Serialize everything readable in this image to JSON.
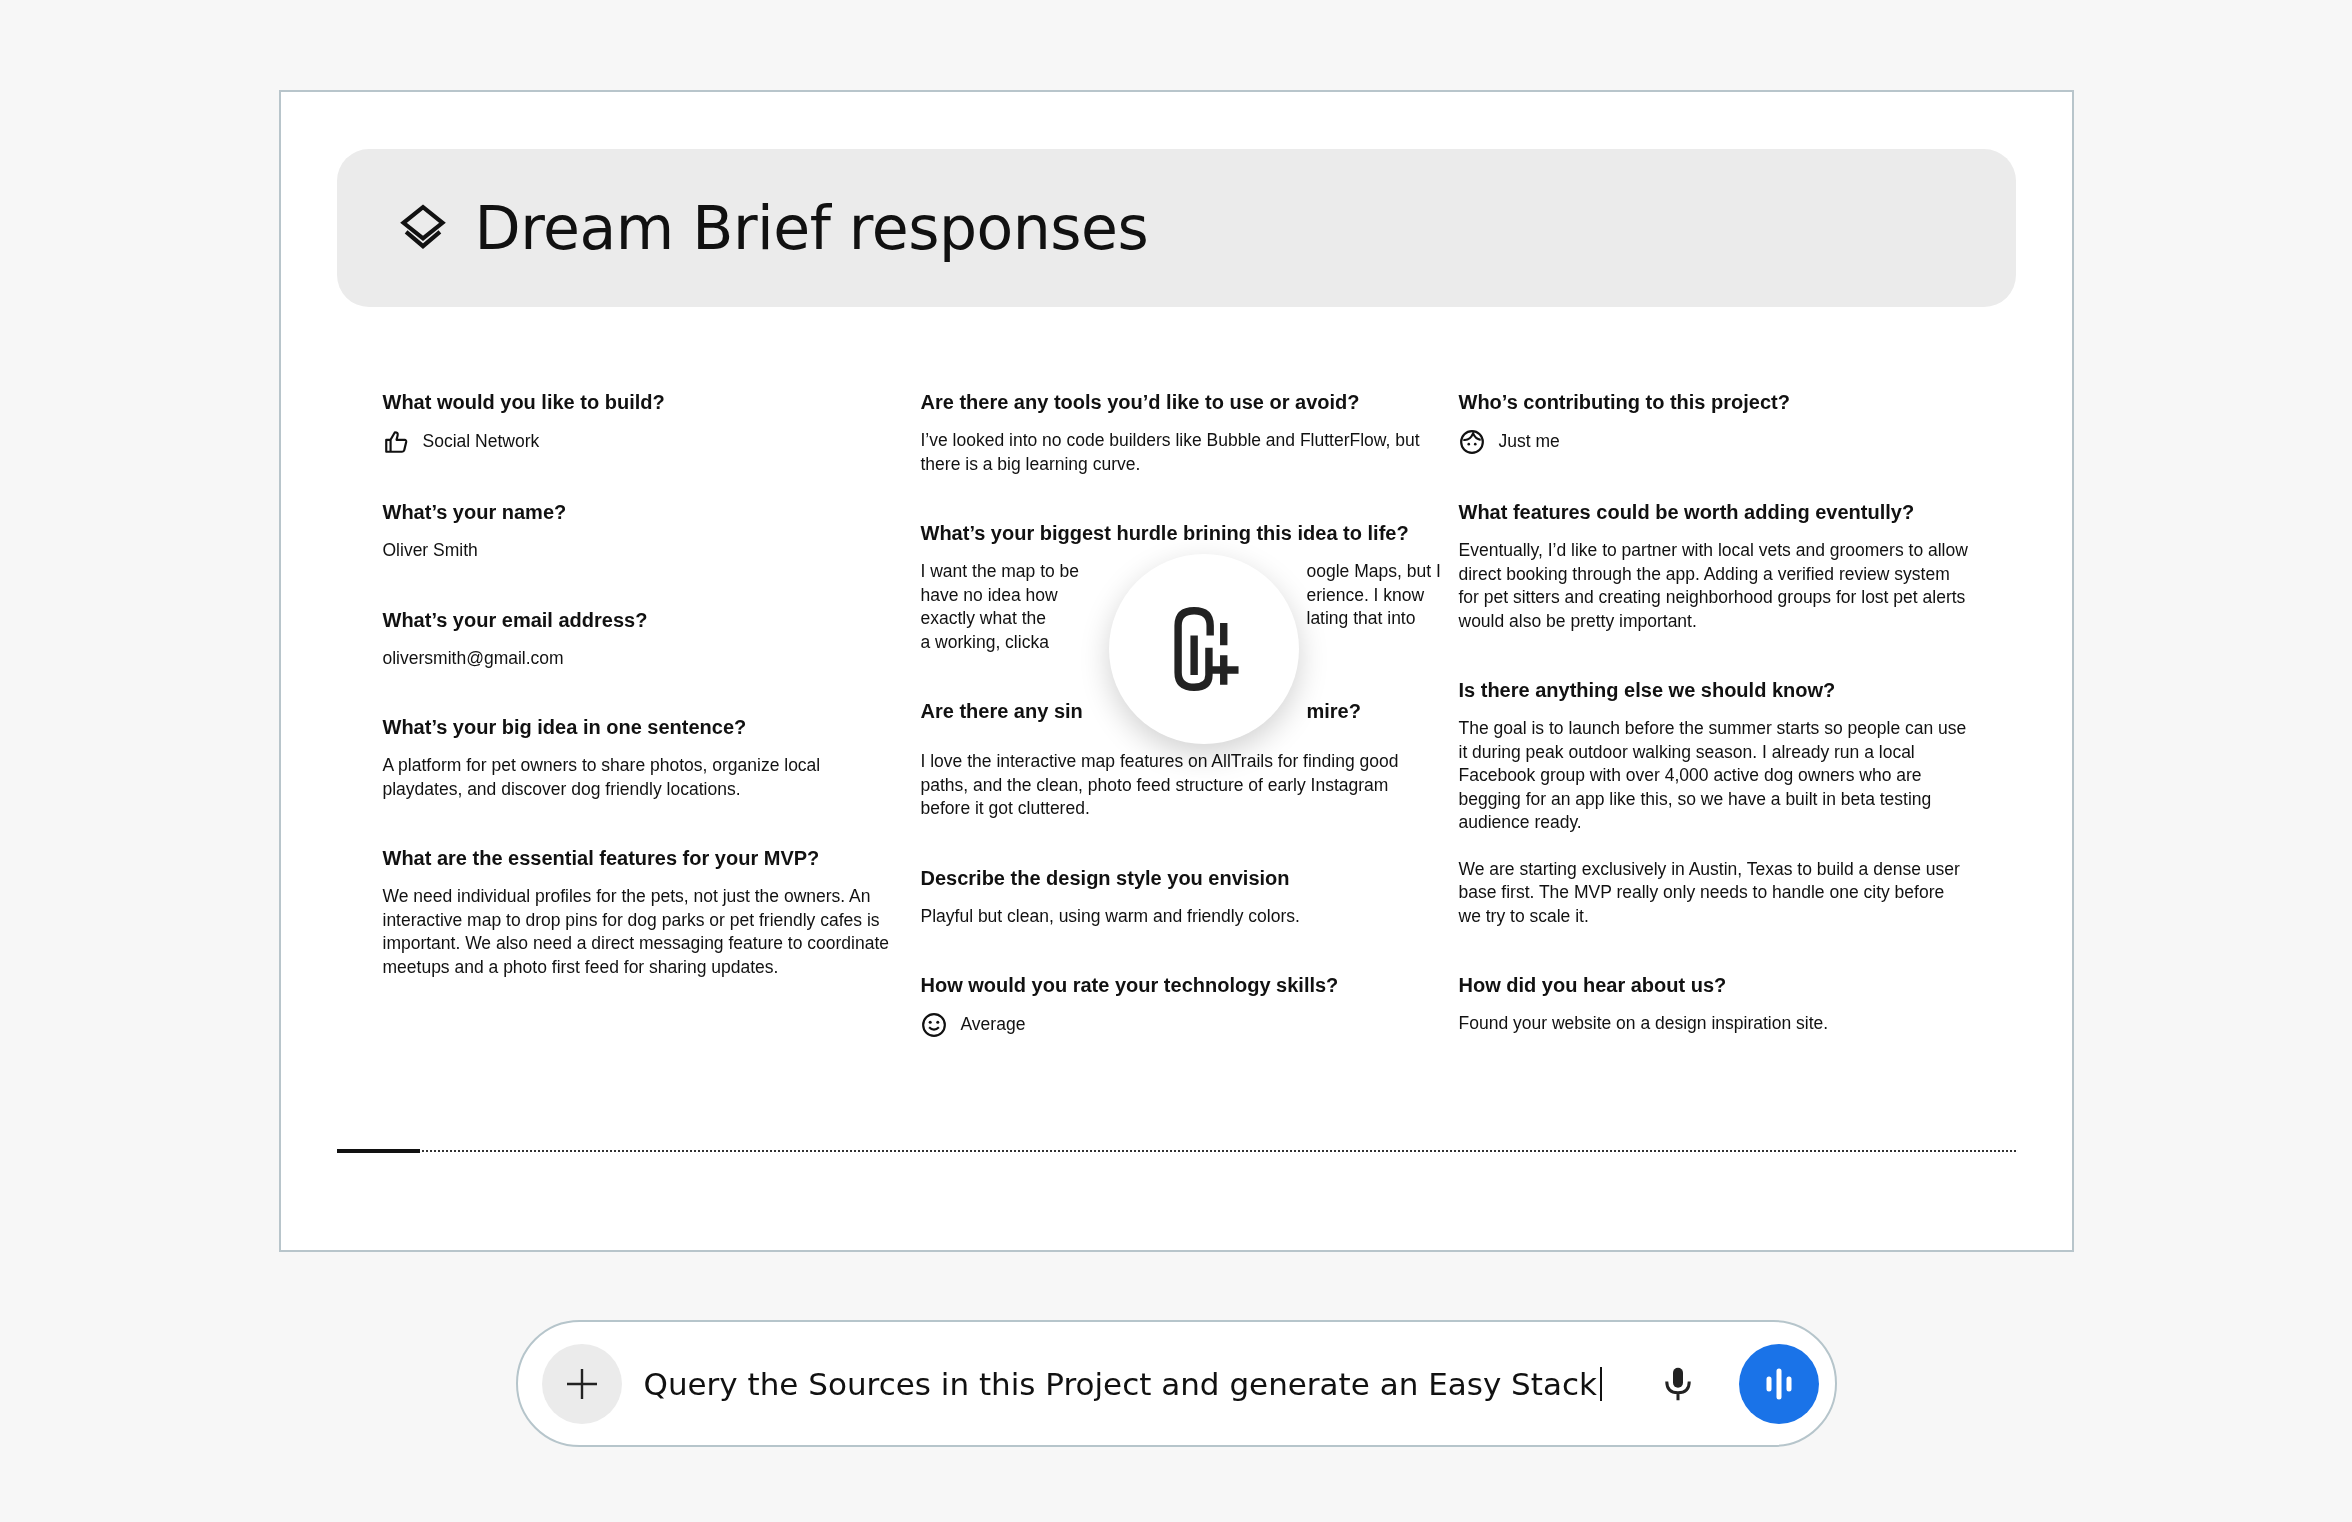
{
  "title": "Dream Brief responses",
  "columns": [
    [
      {
        "kind": "choice",
        "question": "What would you like to build?",
        "answer": "Social Network"
      },
      {
        "kind": "text",
        "question": "What’s your name?",
        "answer": [
          "Oliver Smith"
        ]
      },
      {
        "kind": "text",
        "question": "What’s your email address?",
        "answer": [
          "oliversmith@gmail.com"
        ]
      },
      {
        "kind": "text",
        "question": "What’s your big idea in one sentence?",
        "answer": [
          "A platform for pet owners to share photos, organize local playdates, and discover dog friendly locations."
        ]
      },
      {
        "kind": "text",
        "question": "What are the essential features for your MVP?",
        "answer": [
          "We need individual profiles for the pets, not just the owners. An interactive map to drop pins for dog parks or pet friendly cafes is important. We also need a direct messaging feature to coordinate meetups and a photo first feed for sharing updates."
        ]
      }
    ],
    [
      {
        "kind": "text",
        "question": "Are there any tools you’d like to use or avoid?",
        "answer": [
          "I’ve looked into no code builders like Bubble and FlutterFlow, but there is a big learning curve."
        ]
      },
      {
        "kind": "covered",
        "question": "What’s your biggest hurdle brining this idea to life?",
        "lines": [
          {
            "left": "I want the map to be",
            "right": "oogle Maps, but I"
          },
          {
            "left": "have no idea how",
            "right": "erience. I know"
          },
          {
            "left": "exactly what the",
            "right": "lating that into"
          },
          {
            "left": "a working, clicka"
          }
        ]
      },
      {
        "kind": "covered_question",
        "question_left": "Are there any sin",
        "question_right": "mire?",
        "answer": [
          "I love the interactive map features on AllTrails for finding good paths, and the clean, photo feed structure of early Instagram before it got cluttered."
        ]
      },
      {
        "kind": "text",
        "question": "Describe the design style you envision",
        "answer": [
          "Playful but clean, using warm and friendly colors."
        ]
      },
      {
        "kind": "choice",
        "question": "How would you rate your technology skills?",
        "answer": "Average"
      }
    ],
    [
      {
        "kind": "choice",
        "question": "Who’s contributing to this project?",
        "answer": "Just me"
      },
      {
        "kind": "text",
        "question": "What features could be worth adding eventully?",
        "answer": [
          "Eventually, I’d like to partner with local vets and groomers to allow direct booking through the app. Adding a verified review system for pet sitters and creating neighborhood groups for lost pet alerts would also be pretty important."
        ]
      },
      {
        "kind": "text",
        "question": "Is there anything else we should know?",
        "answer": [
          "The goal is to launch before the summer starts so people can use it during peak outdoor walking season. I already run a local Facebook group with over 4,000 active dog owners who are begging for an app like this, so we have a built in beta testing audience ready.",
          "We are starting exclusively in Austin, Texas to build a dense user base first. The MVP really only needs to handle one city before we try to scale it."
        ]
      },
      {
        "kind": "text",
        "question": "How did you hear about us?",
        "answer": [
          "Found your website on a design inspiration site."
        ]
      }
    ]
  ],
  "progress": {
    "level": 0.05
  },
  "prompt": {
    "value": "Query the Sources in this Project and generate an Easy Stack"
  }
}
